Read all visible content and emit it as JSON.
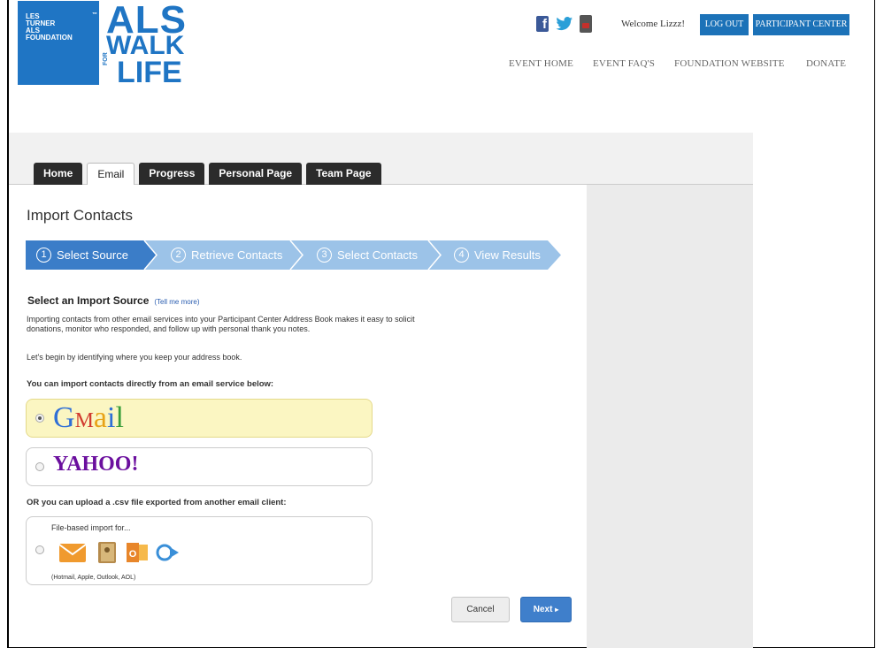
{
  "header": {
    "logo_lines": [
      "LES",
      "TURNER",
      "ALS",
      "FOUNDATION"
    ],
    "title_line1": "ALS",
    "title_line2": "WALK",
    "title_for": "FOR",
    "title_line3": "LIFE",
    "welcome": "Welcome Lizzz!",
    "logout_label": "LOG OUT",
    "participant_center_label": "PARTICIPANT CENTER",
    "nav": [
      "EVENT HOME",
      "EVENT FAQ'S",
      "FOUNDATION WEBSITE",
      "DONATE"
    ]
  },
  "tabs": [
    "Home",
    "Email",
    "Progress",
    "Personal Page",
    "Team Page"
  ],
  "active_tab": "Email",
  "page_title": "Import Contacts",
  "wizard": {
    "steps": [
      {
        "num": "1",
        "label": "Select Source",
        "active": true
      },
      {
        "num": "2",
        "label": "Retrieve Contacts",
        "active": false
      },
      {
        "num": "3",
        "label": "Select Contacts",
        "active": false
      },
      {
        "num": "4",
        "label": "View Results",
        "active": false
      }
    ],
    "active_color": "#3b7dc8",
    "inactive_color": "#9cc3e8"
  },
  "section": {
    "title": "Select an Import Source",
    "tell_me_more": "(Tell me more)",
    "intro_line1": "Importing contacts from other email services into your Participant Center Address Book makes it easy to solicit",
    "intro_line2": "donations, monitor who responded, and follow up with personal thank you notes.",
    "begin": "Let's begin by identifying where you keep your address book.",
    "direct_label": "You can import contacts directly from an email service below:",
    "csv_label": "OR you can upload a .csv file exported from another email client:"
  },
  "options": {
    "gmail": {
      "g": "G",
      "m": "M",
      "a": "a",
      "i": "i",
      "l": "l",
      "selected": true
    },
    "yahoo": {
      "text": "YAHOO!",
      "selected": false
    },
    "file": {
      "label": "File-based import for...",
      "note": "(Hotmail, Apple, Outlook, AOL)",
      "selected": false,
      "icons": [
        "hotmail-envelope-icon",
        "apple-addressbook-icon",
        "outlook-icon",
        "aol-icon"
      ]
    }
  },
  "buttons": {
    "cancel": "Cancel",
    "next": "Next",
    "next_arrow": "▸"
  },
  "colors": {
    "brand_blue": "#1f75c4",
    "header_button": "#1c72b8",
    "next_button": "#3f7fcb",
    "selected_option_bg": "#fbf6c2"
  }
}
